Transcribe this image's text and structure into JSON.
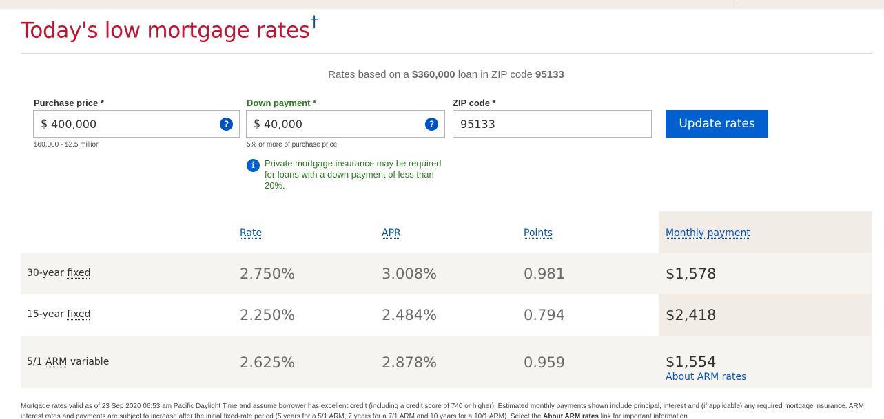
{
  "title": {
    "text": "Today's low mortgage rates",
    "dagger": "†"
  },
  "summary": {
    "prefix": "Rates based on a",
    "loan_amount": "$360,000",
    "middle": "loan in ZIP code",
    "zip": "95133"
  },
  "form": {
    "purchase_price": {
      "label": "Purchase price *",
      "currency": "$",
      "value": "400,000",
      "hint": "$60,000 - $2.5 million"
    },
    "down_payment": {
      "label": "Down payment *",
      "currency": "$",
      "value": "40,000",
      "hint": "5% or more of purchase price"
    },
    "zip_code": {
      "label": "ZIP code *",
      "value": "95133"
    },
    "help_glyph": "?",
    "update_button": "Update rates",
    "pmi_note": {
      "icon": "i",
      "text": "Private mortgage insurance may be required for loans with a down payment of less than 20%."
    }
  },
  "table": {
    "headers": {
      "rate": "Rate",
      "apr": "APR",
      "points": "Points",
      "monthly_payment": "Monthly payment"
    },
    "rows": [
      {
        "term": "30-year",
        "type": "fixed",
        "suffix": "",
        "rate": "2.750%",
        "apr": "3.008%",
        "points": "0.981",
        "payment": "$1,578"
      },
      {
        "term": "15-year",
        "type": "fixed",
        "suffix": "",
        "rate": "2.250%",
        "apr": "2.484%",
        "points": "0.794",
        "payment": "$2,418"
      },
      {
        "term": "5/1",
        "type": "ARM",
        "suffix": "variable",
        "rate": "2.625%",
        "apr": "2.878%",
        "points": "0.959",
        "payment": "$1,554",
        "link": "About ARM rates"
      }
    ]
  },
  "disclaimer": {
    "part1": "Mortgage rates valid as of 23 Sep 2020 06:53 am Pacific Daylight Time and assume borrower has excellent credit (including a credit score of 740 or higher). Estimated monthly payments shown include principal, interest and (if applicable) any required mortgage insurance. ARM interest rates and payments are subject to increase after the initial fixed-rate period (5 years for a 5/1 ARM, 7 years for a 7/1 ARM and 10 years for a 10/1 ARM). Select the",
    "link": "About ARM rates",
    "part2": "link for important information."
  },
  "colors": {
    "title": "#c41230",
    "link": "#0052c2",
    "button": "#0060d0",
    "note_green": "#2a7d1f",
    "band": "#f1ede6"
  },
  "icons": {
    "help": "question-circle-icon",
    "info": "info-circle-icon"
  }
}
